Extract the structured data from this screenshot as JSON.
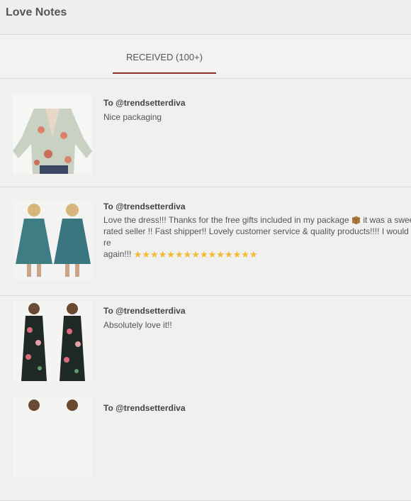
{
  "app": {
    "title": "Love Notes"
  },
  "tabs": [
    {
      "label": "RECEIVED (100+)",
      "active": true
    }
  ],
  "notes": [
    {
      "to": "To @trendsetterdiva",
      "text": "Nice packaging"
    },
    {
      "to": "To @trendsetterdiva",
      "text_part1": "Love the dress!!! Thanks for the free gifts included in my package",
      "text_part2": " it was a swee",
      "text_line2": "rated seller !! Fast shipper!! Lovely customer service & quality products!!!! I would re",
      "text_line3": "again!!!",
      "package_icon": "package-icon",
      "stars": 15
    },
    {
      "to": "To @trendsetterdiva",
      "text": "Absolutely love it!!"
    },
    {
      "to": "To @trendsetterdiva"
    }
  ],
  "colors": {
    "accent": "#8f2c2c",
    "star": "#f3b92f",
    "background": "#e9e9e7"
  }
}
